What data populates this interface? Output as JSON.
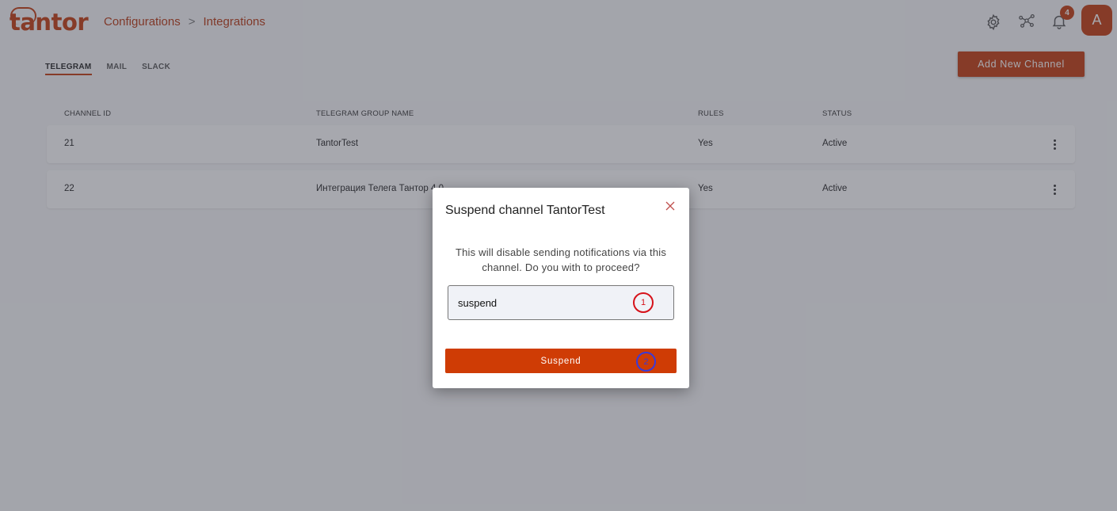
{
  "app": {
    "logo_text": "tantor",
    "breadcrumb": [
      "Configurations",
      "Integrations"
    ],
    "breadcrumb_separator": ">",
    "notification_count": "4",
    "avatar_initial": "A",
    "brand_color": "#c43a0c"
  },
  "tabs": [
    {
      "label": "TELEGRAM",
      "active": true
    },
    {
      "label": "MAIL",
      "active": false
    },
    {
      "label": "SLACK",
      "active": false
    }
  ],
  "toolbar": {
    "add_channel_label": "Add New Channel"
  },
  "table": {
    "headers": [
      "CHANNEL ID",
      "TELEGRAM GROUP NAME",
      "RULES",
      "STATUS"
    ],
    "rows": [
      {
        "id": "21",
        "name": "TantorTest",
        "rules": "Yes",
        "status": "Active"
      },
      {
        "id": "22",
        "name": "Интеграция Телега Тантор 4.0",
        "rules": "Yes",
        "status": "Active"
      }
    ]
  },
  "modal": {
    "title": "Suspend channel TantorTest",
    "message": "This will disable sending notifications via this channel. Do you with to proceed?",
    "input_value": "suspend",
    "confirm_label": "Suspend",
    "marker_1": "1",
    "marker_2": "2"
  },
  "icons": {
    "settings": "gear-icon",
    "network": "network-icon",
    "notifications": "bell-icon",
    "close": "close-icon",
    "row_menu": "more-vertical-icon"
  }
}
